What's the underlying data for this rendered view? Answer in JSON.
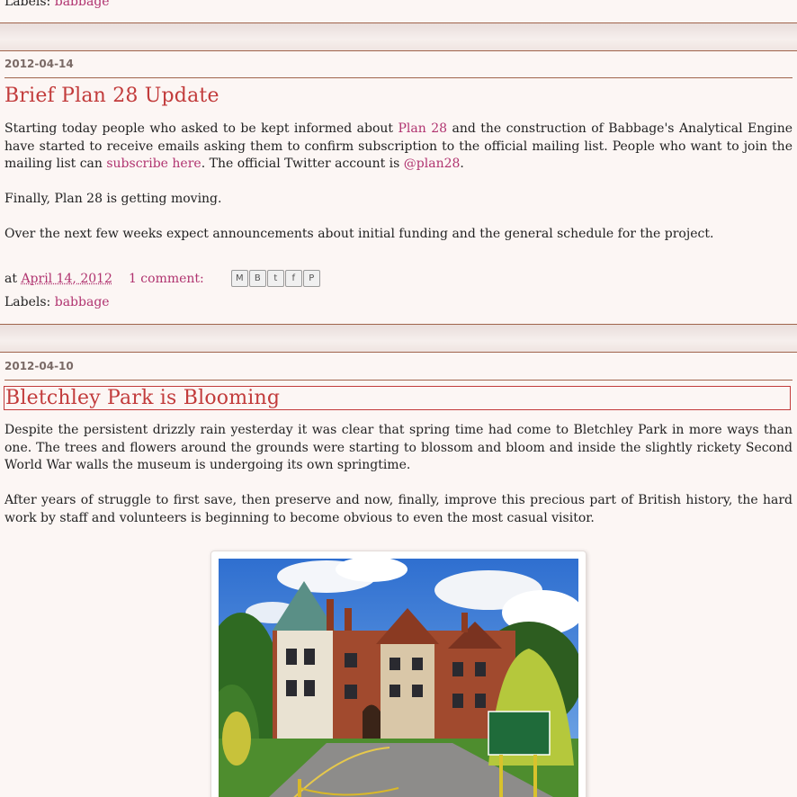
{
  "previous_post": {
    "labels_prefix": "Labels:",
    "label_link": "babbage"
  },
  "post1": {
    "date": "2012-04-14",
    "title": "Brief Plan 28 Update",
    "p1_a": "Starting today people who asked to be kept informed about ",
    "p1_link1": "Plan 28",
    "p1_b": " and the construction of Babbage's Analytical Engine have started to receive emails asking them to confirm subscription to the official mailing list.  People who want to join the mailing list can ",
    "p1_link2": "subscribe here",
    "p1_c": ".  The official Twitter account is ",
    "p1_link3": "@plan28",
    "p1_d": ".",
    "p2": "Finally, Plan 28 is getting moving.",
    "p3": "Over the next few weeks expect announcements about initial funding and the general schedule for the project.",
    "at": "at",
    "timestamp": "April 14, 2012",
    "comments": "1 comment:",
    "labels_prefix": "Labels:",
    "label_link": "babbage"
  },
  "post2": {
    "date": "2012-04-10",
    "title": "Bletchley Park is Blooming",
    "p1": "Despite the persistent drizzly rain yesterday it was clear that spring time had come to Bletchley Park in more ways than one.  The trees and flowers around the grounds were starting to blossom and bloom and inside the slightly rickety Second World War walls the museum is undergoing its own springtime.",
    "p2": "After years of struggle to first save, then preserve and now, finally, improve this precious part of British history, the hard work by staff and volunteers is beginning to become obvious to even the most casual visitor."
  },
  "share": {
    "icons": [
      "email-icon",
      "blogger-icon",
      "twitter-icon",
      "facebook-icon",
      "pinterest-icon"
    ],
    "glyphs": [
      "M",
      "B",
      "t",
      "f",
      "P"
    ]
  },
  "colors": {
    "background": "#fcf6f4",
    "link": "#b0336f",
    "title": "#c23b3b",
    "rule": "#a0644c"
  }
}
